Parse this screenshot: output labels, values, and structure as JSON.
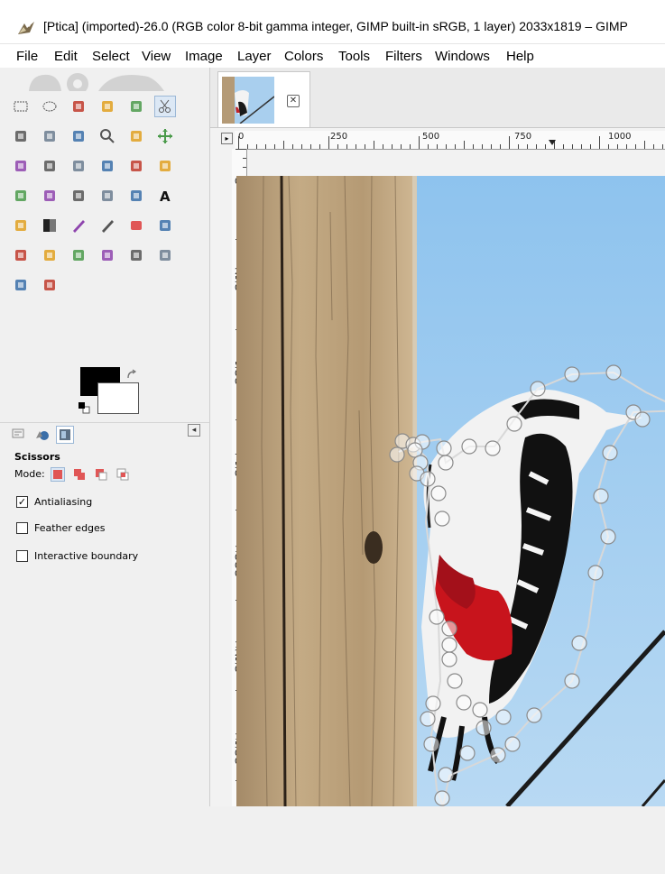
{
  "window": {
    "title": "[Ptica] (imported)-26.0 (RGB color 8-bit gamma integer, GIMP built-in sRGB, 1 layer) 2033x1819 – GIMP",
    "icon": "gimp-wilber-icon"
  },
  "menubar": {
    "items": [
      "File",
      "Edit",
      "Select",
      "View",
      "Image",
      "Layer",
      "Colors",
      "Tools",
      "Filters",
      "Windows",
      "Help"
    ]
  },
  "toolbox": {
    "tools": [
      "rect-select-icon",
      "ellipse-select-icon",
      "free-select-icon",
      "fuzzy-select-icon",
      "select-by-color-icon",
      "scissors-select-icon",
      "foreground-select-icon",
      "paths-icon",
      "color-picker-icon",
      "zoom-icon",
      "measure-icon",
      "move-icon",
      "align-icon",
      "crop-icon",
      "unified-transform-icon",
      "rotate-icon",
      "scale-icon",
      "shear-icon",
      "perspective-icon",
      "handle-transform-icon",
      "flip-icon",
      "cage-icon",
      "warp-icon",
      "text-icon",
      "bucket-fill-icon",
      "gradient-icon",
      "pencil-icon",
      "paintbrush-icon",
      "eraser-icon",
      "airbrush-icon",
      "ink-icon",
      "mypaint-brush-icon",
      "clone-icon",
      "heal-icon",
      "perspective-clone-icon",
      "blur-sharpen-icon",
      "smudge-icon",
      "dodge-burn-icon"
    ],
    "active_tool_index": 5,
    "colors": {
      "foreground": "#000000",
      "background": "#ffffff"
    }
  },
  "tool_options": {
    "title": "Scissors",
    "mode_label": "Mode:",
    "antialiasing": {
      "label": "Antialiasing",
      "checked": true
    },
    "feather": {
      "label": "Feather edges",
      "checked": false
    },
    "interactive": {
      "label": "Interactive boundary",
      "checked": false
    }
  },
  "image_tab": {
    "close_glyph": "✕"
  },
  "ruler": {
    "top_labels": [
      "0",
      "250",
      "500",
      "750",
      "1000"
    ],
    "left_labels": [
      "0",
      "250",
      "500",
      "750",
      "1000",
      "1250",
      "1500"
    ]
  },
  "colors": {
    "accent": "#9cb8d6",
    "sky": "#9fcbef",
    "selection": "#e9e9e9"
  }
}
